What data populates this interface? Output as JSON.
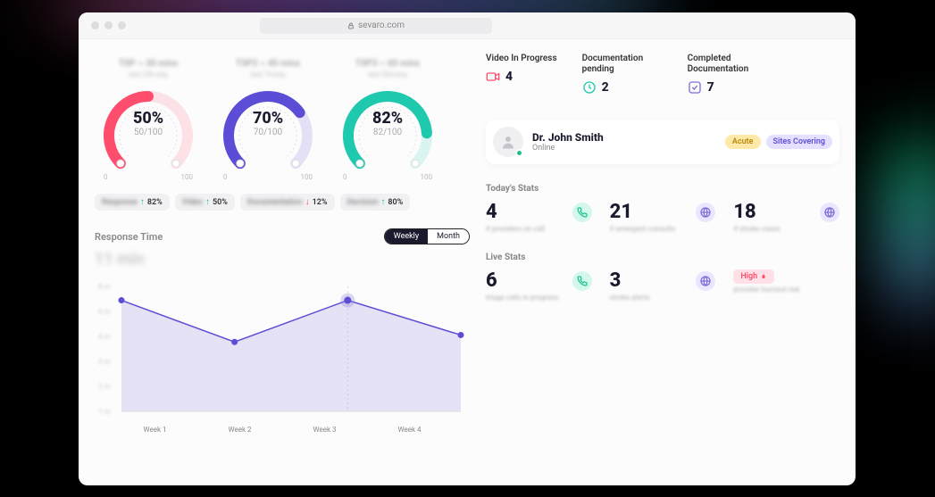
{
  "url": "sevaro.com",
  "gauges": [
    {
      "title": "TSP ~ 30 mins",
      "sub": "last 24h avg",
      "pct": "50%",
      "frac": "50/100",
      "color": "#ff4d6d",
      "value": 50
    },
    {
      "title": "TSP2 ~ 45 mins",
      "sub": "last 7d avg",
      "pct": "70%",
      "frac": "70/100",
      "color": "#5b4dd6",
      "value": 70
    },
    {
      "title": "TSP3 ~ 60 mins",
      "sub": "last 30d avg",
      "pct": "82%",
      "frac": "82/100",
      "color": "#1ec9ad",
      "value": 82
    }
  ],
  "gauge_scale": {
    "min": "0",
    "max": "100"
  },
  "pills": [
    {
      "label": "Response",
      "dir": "up",
      "pct": "82%"
    },
    {
      "label": "Video",
      "dir": "up",
      "pct": "50%"
    },
    {
      "label": "Documentation",
      "dir": "down",
      "pct": "12%"
    },
    {
      "label": "Decision",
      "dir": "up",
      "pct": "80%"
    }
  ],
  "chart": {
    "title": "Response Time",
    "big": "11 min",
    "toggle": {
      "active": "Weekly",
      "inactive": "Month"
    }
  },
  "chart_data": {
    "type": "line",
    "categories": [
      "Week 1",
      "Week 2",
      "Week 3",
      "Week 4"
    ],
    "values": [
      8,
      5,
      8,
      5.5
    ],
    "yticks": [
      "8 m",
      "6 m",
      "4 m",
      "3 m",
      "2 m",
      "1 m"
    ],
    "ylim": [
      0,
      9
    ]
  },
  "status": [
    {
      "label": "Video In Progress",
      "value": "4",
      "icon": "video",
      "color": "#ff4d6d"
    },
    {
      "label": "Documentation pending",
      "value": "2",
      "icon": "clock",
      "color": "#1ec9ad"
    },
    {
      "label": "Completed Documentation",
      "value": "7",
      "icon": "check",
      "color": "#7b6dd6"
    }
  ],
  "profile": {
    "name": "Dr. John Smith",
    "status": "Online",
    "badges": [
      "Acute",
      "Sites Covering"
    ]
  },
  "today": {
    "title": "Today's Stats",
    "items": [
      {
        "val": "4",
        "sub": "# providers on call",
        "icon": "phone",
        "variant": "teal"
      },
      {
        "val": "21",
        "sub": "# emergent consults",
        "icon": "globe",
        "variant": "purple"
      },
      {
        "val": "18",
        "sub": "# stroke cases",
        "icon": "globe",
        "variant": "purple"
      }
    ]
  },
  "live": {
    "title": "Live Stats",
    "items": [
      {
        "val": "6",
        "sub": "triage calls in progress",
        "icon": "phone",
        "variant": "teal"
      },
      {
        "val": "3",
        "sub": "stroke alerts",
        "icon": "globe",
        "variant": "purple"
      }
    ],
    "risk": {
      "label": "High",
      "sub": "provider burnout risk"
    }
  }
}
